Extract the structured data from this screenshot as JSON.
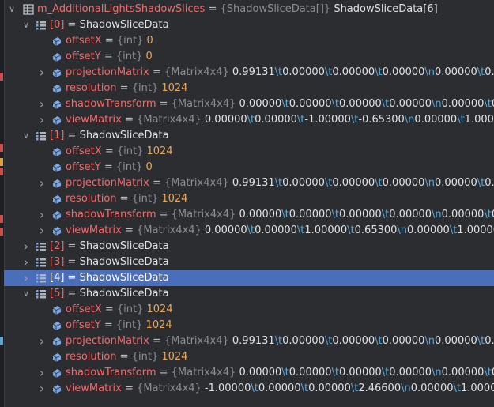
{
  "root": {
    "name": "m_AdditionalLightsShadowSlices",
    "type": "{ShadowSliceData[]}",
    "value": "ShadowSliceData[6]"
  },
  "rows": [
    {
      "level": 1,
      "expand": "open",
      "icon": "array",
      "name": "[0]",
      "value": "ShadowSliceData"
    },
    {
      "level": 2,
      "expand": "none",
      "icon": "field",
      "name": "offsetX",
      "type": "{int}",
      "value": "0",
      "num": true
    },
    {
      "level": 2,
      "expand": "none",
      "icon": "field",
      "name": "offsetY",
      "type": "{int}",
      "value": "0",
      "num": true
    },
    {
      "level": 2,
      "expand": "closed",
      "icon": "field",
      "name": "projectionMatrix",
      "type": "{Matrix4x4}",
      "value": "0.99131\\t0.00000\\t0.00000\\t0.00000\\n0.00000\\t0.99"
    },
    {
      "level": 2,
      "expand": "none",
      "icon": "field",
      "name": "resolution",
      "type": "{int}",
      "value": "1024",
      "num": true
    },
    {
      "level": 2,
      "expand": "closed",
      "icon": "field",
      "name": "shadowTransform",
      "type": "{Matrix4x4}",
      "value": "0.00000\\t0.00000\\t0.00000\\t0.00000\\n0.00000\\t0.00000"
    },
    {
      "level": 2,
      "expand": "closed",
      "icon": "field",
      "name": "viewMatrix",
      "type": "{Matrix4x4}",
      "value": "0.00000\\t0.00000\\t-1.00000\\t-0.65300\\n0.00000\\t1.00000"
    },
    {
      "level": 1,
      "expand": "open",
      "icon": "array",
      "name": "[1]",
      "value": "ShadowSliceData"
    },
    {
      "level": 2,
      "expand": "none",
      "icon": "field",
      "name": "offsetX",
      "type": "{int}",
      "value": "1024",
      "num": true
    },
    {
      "level": 2,
      "expand": "none",
      "icon": "field",
      "name": "offsetY",
      "type": "{int}",
      "value": "0",
      "num": true
    },
    {
      "level": 2,
      "expand": "closed",
      "icon": "field",
      "name": "projectionMatrix",
      "type": "{Matrix4x4}",
      "value": "0.99131\\t0.00000\\t0.00000\\t0.00000\\n0.00000\\t0.99"
    },
    {
      "level": 2,
      "expand": "none",
      "icon": "field",
      "name": "resolution",
      "type": "{int}",
      "value": "1024",
      "num": true
    },
    {
      "level": 2,
      "expand": "closed",
      "icon": "field",
      "name": "shadowTransform",
      "type": "{Matrix4x4}",
      "value": "0.00000\\t0.00000\\t0.00000\\t0.00000\\n0.00000\\t0.00000"
    },
    {
      "level": 2,
      "expand": "closed",
      "icon": "field",
      "name": "viewMatrix",
      "type": "{Matrix4x4}",
      "value": "0.00000\\t0.00000\\t1.00000\\t0.65300\\n0.00000\\t1.00000\\t0"
    },
    {
      "level": 1,
      "expand": "closed",
      "icon": "array",
      "name": "[2]",
      "value": "ShadowSliceData"
    },
    {
      "level": 1,
      "expand": "closed",
      "icon": "array",
      "name": "[3]",
      "value": "ShadowSliceData"
    },
    {
      "level": 1,
      "expand": "closed",
      "icon": "array",
      "name": "[4]",
      "value": "ShadowSliceData",
      "selected": true
    },
    {
      "level": 1,
      "expand": "open",
      "icon": "array",
      "name": "[5]",
      "value": "ShadowSliceData"
    },
    {
      "level": 2,
      "expand": "none",
      "icon": "field",
      "name": "offsetX",
      "type": "{int}",
      "value": "1024",
      "num": true
    },
    {
      "level": 2,
      "expand": "none",
      "icon": "field",
      "name": "offsetY",
      "type": "{int}",
      "value": "1024",
      "num": true
    },
    {
      "level": 2,
      "expand": "closed",
      "icon": "field",
      "name": "projectionMatrix",
      "type": "{Matrix4x4}",
      "value": "0.99131\\t0.00000\\t0.00000\\t0.00000\\n0.00000\\t0.99"
    },
    {
      "level": 2,
      "expand": "none",
      "icon": "field",
      "name": "resolution",
      "type": "{int}",
      "value": "1024",
      "num": true
    },
    {
      "level": 2,
      "expand": "closed",
      "icon": "field",
      "name": "shadowTransform",
      "type": "{Matrix4x4}",
      "value": "0.00000\\t0.00000\\t0.00000\\t0.00000\\n0.00000\\t0.00000"
    },
    {
      "level": 2,
      "expand": "closed",
      "icon": "field",
      "name": "viewMatrix",
      "type": "{Matrix4x4}",
      "value": "-1.00000\\t0.00000\\t0.00000\\t2.46600\\n0.00000\\t1.00000\\t"
    }
  ],
  "icons": {
    "root": "array-table-icon",
    "array": "list-icon",
    "field": "field-icon",
    "expand_open": "chevron-down-icon",
    "expand_closed": "chevron-right-icon"
  },
  "colors": {
    "background": "#2b2d30",
    "name": "#ee6c6c",
    "type": "#8b8e94",
    "number": "#e8a85a",
    "escape": "#5aa7d6",
    "selection": "#4a6eba",
    "icon": "#7aa7e8"
  }
}
